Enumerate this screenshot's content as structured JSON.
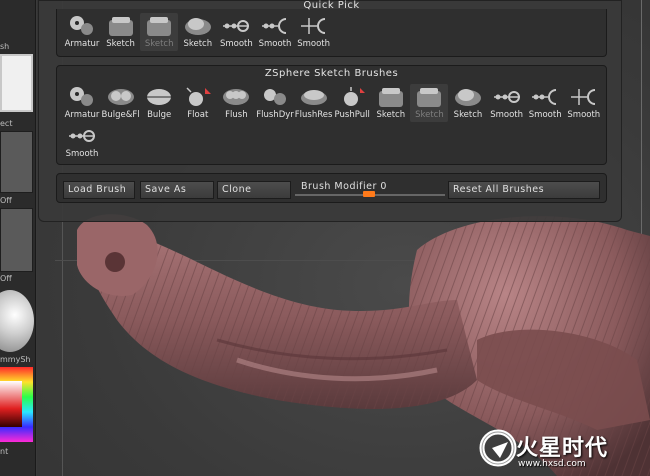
{
  "left_shelf": {
    "labels": [
      "sh",
      "ect",
      "Off",
      "Off",
      "mmySh",
      "nt"
    ]
  },
  "quick_pick": {
    "title": "Quick Pick",
    "tools": [
      {
        "label": "Armatur",
        "icon": "armature-icon",
        "dim": false
      },
      {
        "label": "Sketch",
        "icon": "sketch-block-icon",
        "dim": false
      },
      {
        "label": "Sketch",
        "icon": "sketch-block-icon",
        "dim": true
      },
      {
        "label": "Sketch",
        "icon": "sketch-blob-icon",
        "dim": false
      },
      {
        "label": "Smooth",
        "icon": "smooth-chain-icon",
        "dim": false
      },
      {
        "label": "Smooth",
        "icon": "smooth-arc-icon",
        "dim": false
      },
      {
        "label": "Smooth",
        "icon": "smooth-arrow-icon",
        "dim": false
      }
    ]
  },
  "zsphere_brushes": {
    "title": "ZSphere Sketch Brushes",
    "tools": [
      {
        "label": "Armatur",
        "icon": "armature-icon",
        "dim": false
      },
      {
        "label": "Bulge&Fl",
        "icon": "bulge-fill-icon",
        "dim": false
      },
      {
        "label": "Bulge",
        "icon": "bulge-icon",
        "dim": false
      },
      {
        "label": "Float",
        "icon": "float-icon",
        "dim": false
      },
      {
        "label": "Flush",
        "icon": "flush-icon",
        "dim": false
      },
      {
        "label": "FlushDyr",
        "icon": "flush-dynamic-icon",
        "dim": false
      },
      {
        "label": "FlushRes",
        "icon": "flush-res-icon",
        "dim": false
      },
      {
        "label": "PushPull",
        "icon": "push-pull-icon",
        "dim": false
      },
      {
        "label": "Sketch",
        "icon": "sketch-block-icon",
        "dim": false
      },
      {
        "label": "Sketch",
        "icon": "sketch-block-icon",
        "dim": true
      },
      {
        "label": "Sketch",
        "icon": "sketch-blob-icon",
        "dim": false
      },
      {
        "label": "Smooth",
        "icon": "smooth-chain-icon",
        "dim": false
      },
      {
        "label": "Smooth",
        "icon": "smooth-arc-icon",
        "dim": false
      },
      {
        "label": "Smooth",
        "icon": "smooth-arrow-icon",
        "dim": false
      },
      {
        "label": "Smooth",
        "icon": "smooth-chain-icon",
        "dim": false
      }
    ]
  },
  "bottom_bar": {
    "load_brush": "Load Brush",
    "save_as": "Save As",
    "clone": "Clone",
    "brush_modifier_label": "Brush Modifier",
    "brush_modifier_value": "0",
    "brush_modifier_fraction": 0.0,
    "reset_all": "Reset All Brushes"
  },
  "watermark": {
    "text": "火星时代",
    "url": "www.hxsd.com"
  },
  "colors": {
    "accent": "#ff7a1a",
    "panel": "#3a3a3a",
    "section": "#2f2f2f",
    "model_skin": "#8a5a5c"
  }
}
